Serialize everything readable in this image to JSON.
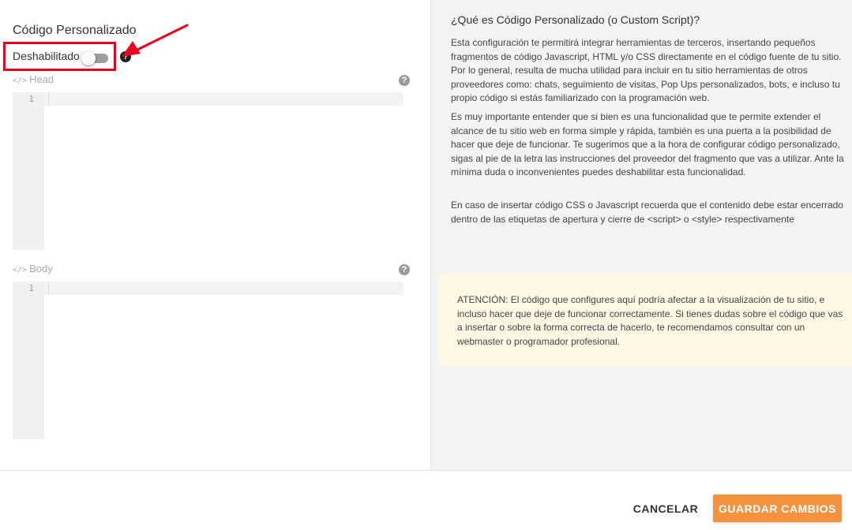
{
  "custom_script": {
    "title": "Código Personalizado",
    "toggle_label": "Deshabilitado",
    "toggle_state": "off",
    "help_icon": "?"
  },
  "editors": {
    "head": {
      "icon": "</>",
      "label": "Head",
      "line_number": "1",
      "help_icon": "?"
    },
    "body": {
      "icon": "</>",
      "label": "Body",
      "line_number": "1",
      "help_icon": "?"
    }
  },
  "info": {
    "title": "¿Qué es Código Personalizado (o Custom Script)?",
    "paragraphs": [
      "Esta configuración te permitirá integrar herramientas de terceros, insertando pequeños fragmentos de código Javascript, HTML y/o CSS directamente en el código fuente de tu sitio. Por lo general, resulta de mucha utilidad para incluir en tu sitio herramientas de otros proveedores como: chats, seguimiento de visitas, Pop Ups personalizados, bots, e incluso tu propio código si estás familiarizado con la programación web.",
      "Es muy importante entender que si bien es una funcionalidad que te permite extender el alcance de tu sitio web en forma simple y rápida, también es una puerta a la posibilidad de hacer que deje de funcionar. Te sugerimos que a la hora de configurar código personalizado, sigas al pie de la letra las instrucciones del proveedor del fragmento que vas a utilizar. Ante la mínima duda o inconvenientes puedes deshabilitar esta funcionalidad.",
      "En caso de insertar código CSS o Javascript recuerda que el contenido debe estar encerrado dentro de las etiquetas de apertura y cierre de <script> o <style> respectivamente"
    ]
  },
  "warning": {
    "text": "ATENCIÓN: El código que configures aquí podría afectar a la visualización de tu sitio, e incluso hacer que deje de funcionar correctamente. Si tienes dudas sobre el código que vas a insertar o sobre la forma correcta de hacerlo, te recomendamos consultar con un webmaster o programador profesional."
  },
  "footer": {
    "cancel_label": "CANCELAR",
    "save_label": "GUARDAR CAMBIOS"
  },
  "colors": {
    "accent": "#f5923e",
    "highlight_box": "#e8001c",
    "warning_bg": "#fdf8e4"
  }
}
